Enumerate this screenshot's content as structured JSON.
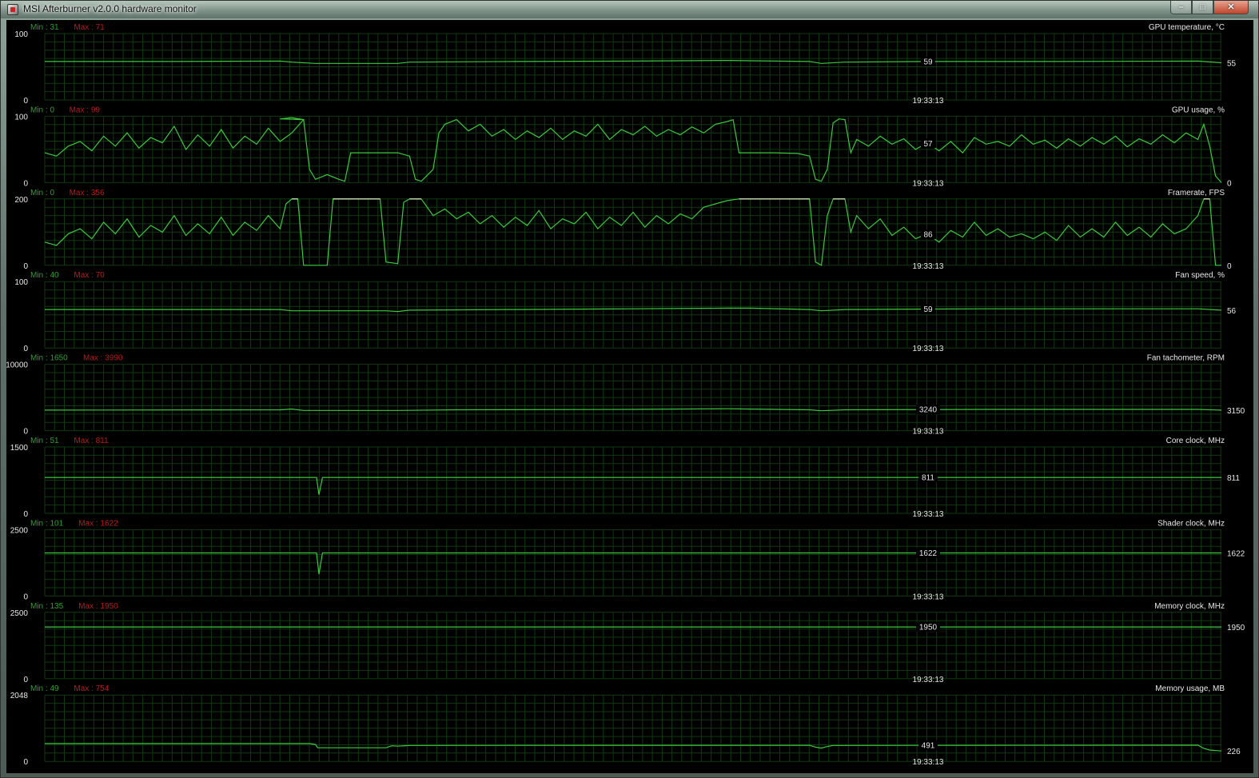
{
  "window": {
    "title": "MSI Afterburner v2.0.0 hardware monitor",
    "buttons": {
      "minimize_icon": "minimize-icon",
      "maximize_icon": "maximize-icon",
      "close_icon": "close-icon"
    }
  },
  "colors": {
    "line": "#3cc83c",
    "grid": "#0e3a0e",
    "min_text": "#2ea02e",
    "max_text": "#c01818",
    "text": "#e8e8e8",
    "saturated_line": "#f0f0d8"
  },
  "time_label": "19:33:13",
  "panels": [
    {
      "title": "GPU temperature, °C",
      "min_label": "Min : 31",
      "max_label": "Max : 71",
      "y_max": 100,
      "y_min": 0,
      "y_max_label": "100",
      "y_min_label": "0",
      "cursor_value": "59",
      "current_value": "55",
      "series": [
        [
          0,
          58
        ],
        [
          0.1,
          58
        ],
        [
          0.2,
          58.5
        ],
        [
          0.21,
          57
        ],
        [
          0.23,
          55
        ],
        [
          0.3,
          55
        ],
        [
          0.31,
          57
        ],
        [
          0.4,
          58
        ],
        [
          0.5,
          58.5
        ],
        [
          0.58,
          59.5
        ],
        [
          0.6,
          59
        ],
        [
          0.65,
          58
        ],
        [
          0.66,
          55
        ],
        [
          0.68,
          57
        ],
        [
          0.75,
          58
        ],
        [
          0.85,
          58
        ],
        [
          0.98,
          58.5
        ],
        [
          1,
          56
        ]
      ]
    },
    {
      "title": "GPU usage, %",
      "min_label": "Min : 0",
      "max_label": "Max : 99",
      "y_max": 100,
      "y_min": 0,
      "y_max_label": "100",
      "y_min_label": "0",
      "cursor_value": "57",
      "current_value": "0",
      "series": [
        [
          0,
          45
        ],
        [
          0.01,
          40
        ],
        [
          0.02,
          55
        ],
        [
          0.03,
          62
        ],
        [
          0.04,
          48
        ],
        [
          0.05,
          70
        ],
        [
          0.06,
          55
        ],
        [
          0.07,
          75
        ],
        [
          0.08,
          52
        ],
        [
          0.09,
          68
        ],
        [
          0.1,
          60
        ],
        [
          0.11,
          85
        ],
        [
          0.12,
          50
        ],
        [
          0.13,
          72
        ],
        [
          0.14,
          55
        ],
        [
          0.15,
          80
        ],
        [
          0.16,
          52
        ],
        [
          0.17,
          70
        ],
        [
          0.18,
          58
        ],
        [
          0.19,
          82
        ],
        [
          0.2,
          62
        ],
        [
          0.21,
          75
        ],
        [
          0.22,
          95
        ],
        [
          0.2,
          96
        ],
        [
          0.21,
          98
        ],
        [
          0.22,
          95
        ],
        [
          0.225,
          20
        ],
        [
          0.23,
          5
        ],
        [
          0.24,
          12
        ],
        [
          0.25,
          5
        ],
        [
          0.255,
          2
        ],
        [
          0.26,
          45
        ],
        [
          0.27,
          45
        ],
        [
          0.3,
          45
        ],
        [
          0.31,
          40
        ],
        [
          0.315,
          5
        ],
        [
          0.32,
          2
        ],
        [
          0.33,
          20
        ],
        [
          0.335,
          75
        ],
        [
          0.34,
          88
        ],
        [
          0.35,
          95
        ],
        [
          0.36,
          78
        ],
        [
          0.37,
          88
        ],
        [
          0.38,
          70
        ],
        [
          0.39,
          80
        ],
        [
          0.4,
          65
        ],
        [
          0.41,
          78
        ],
        [
          0.42,
          68
        ],
        [
          0.43,
          82
        ],
        [
          0.44,
          65
        ],
        [
          0.45,
          78
        ],
        [
          0.46,
          70
        ],
        [
          0.47,
          88
        ],
        [
          0.48,
          65
        ],
        [
          0.49,
          80
        ],
        [
          0.5,
          72
        ],
        [
          0.51,
          85
        ],
        [
          0.52,
          70
        ],
        [
          0.53,
          80
        ],
        [
          0.54,
          72
        ],
        [
          0.55,
          84
        ],
        [
          0.56,
          75
        ],
        [
          0.57,
          88
        ],
        [
          0.58,
          92
        ],
        [
          0.585,
          95
        ],
        [
          0.59,
          45
        ],
        [
          0.6,
          45
        ],
        [
          0.62,
          45
        ],
        [
          0.64,
          44
        ],
        [
          0.65,
          40
        ],
        [
          0.655,
          5
        ],
        [
          0.66,
          2
        ],
        [
          0.665,
          20
        ],
        [
          0.67,
          90
        ],
        [
          0.675,
          96
        ],
        [
          0.68,
          95
        ],
        [
          0.685,
          45
        ],
        [
          0.69,
          65
        ],
        [
          0.7,
          55
        ],
        [
          0.71,
          70
        ],
        [
          0.72,
          58
        ],
        [
          0.73,
          66
        ],
        [
          0.74,
          50
        ],
        [
          0.75,
          60
        ],
        [
          0.76,
          48
        ],
        [
          0.77,
          62
        ],
        [
          0.78,
          45
        ],
        [
          0.79,
          68
        ],
        [
          0.8,
          58
        ],
        [
          0.81,
          62
        ],
        [
          0.82,
          55
        ],
        [
          0.83,
          72
        ],
        [
          0.84,
          58
        ],
        [
          0.85,
          64
        ],
        [
          0.86,
          52
        ],
        [
          0.87,
          66
        ],
        [
          0.88,
          55
        ],
        [
          0.89,
          68
        ],
        [
          0.9,
          58
        ],
        [
          0.91,
          70
        ],
        [
          0.92,
          54
        ],
        [
          0.93,
          66
        ],
        [
          0.94,
          58
        ],
        [
          0.95,
          72
        ],
        [
          0.96,
          60
        ],
        [
          0.97,
          75
        ],
        [
          0.98,
          65
        ],
        [
          0.985,
          88
        ],
        [
          0.99,
          55
        ],
        [
          0.995,
          10
        ],
        [
          1,
          0
        ]
      ]
    },
    {
      "title": "Framerate, FPS",
      "min_label": "Min : 0",
      "max_label": "Max : 356",
      "y_max": 200,
      "y_min": 0,
      "y_max_label": "200",
      "y_min_label": "0",
      "cursor_value": "86",
      "current_value": "0",
      "series": [
        [
          0,
          70
        ],
        [
          0.01,
          60
        ],
        [
          0.02,
          95
        ],
        [
          0.03,
          110
        ],
        [
          0.04,
          80
        ],
        [
          0.05,
          130
        ],
        [
          0.06,
          95
        ],
        [
          0.07,
          140
        ],
        [
          0.08,
          85
        ],
        [
          0.09,
          120
        ],
        [
          0.1,
          100
        ],
        [
          0.11,
          150
        ],
        [
          0.12,
          90
        ],
        [
          0.13,
          125
        ],
        [
          0.14,
          95
        ],
        [
          0.15,
          145
        ],
        [
          0.16,
          90
        ],
        [
          0.17,
          130
        ],
        [
          0.18,
          105
        ],
        [
          0.19,
          150
        ],
        [
          0.2,
          110
        ],
        [
          0.205,
          185
        ],
        [
          0.21,
          200
        ],
        [
          0.215,
          200
        ],
        [
          0.22,
          0
        ],
        [
          0.23,
          0
        ],
        [
          0.24,
          0
        ],
        [
          0.245,
          200
        ],
        [
          0.28,
          200
        ],
        [
          0.285,
          200
        ],
        [
          0.29,
          10
        ],
        [
          0.3,
          5
        ],
        [
          0.305,
          190
        ],
        [
          0.31,
          200
        ],
        [
          0.32,
          200
        ],
        [
          0.33,
          150
        ],
        [
          0.34,
          170
        ],
        [
          0.35,
          140
        ],
        [
          0.36,
          160
        ],
        [
          0.37,
          125
        ],
        [
          0.38,
          150
        ],
        [
          0.39,
          115
        ],
        [
          0.4,
          145
        ],
        [
          0.41,
          120
        ],
        [
          0.42,
          165
        ],
        [
          0.43,
          110
        ],
        [
          0.44,
          140
        ],
        [
          0.45,
          125
        ],
        [
          0.46,
          160
        ],
        [
          0.47,
          110
        ],
        [
          0.48,
          145
        ],
        [
          0.49,
          120
        ],
        [
          0.5,
          160
        ],
        [
          0.51,
          115
        ],
        [
          0.52,
          150
        ],
        [
          0.53,
          125
        ],
        [
          0.54,
          155
        ],
        [
          0.55,
          140
        ],
        [
          0.56,
          175
        ],
        [
          0.57,
          185
        ],
        [
          0.58,
          195
        ],
        [
          0.59,
          200
        ],
        [
          0.6,
          200
        ],
        [
          0.64,
          200
        ],
        [
          0.65,
          200
        ],
        [
          0.655,
          10
        ],
        [
          0.66,
          0
        ],
        [
          0.665,
          150
        ],
        [
          0.67,
          200
        ],
        [
          0.675,
          200
        ],
        [
          0.68,
          200
        ],
        [
          0.685,
          100
        ],
        [
          0.69,
          150
        ],
        [
          0.7,
          110
        ],
        [
          0.71,
          140
        ],
        [
          0.72,
          90
        ],
        [
          0.73,
          115
        ],
        [
          0.74,
          80
        ],
        [
          0.75,
          95
        ],
        [
          0.76,
          70
        ],
        [
          0.77,
          105
        ],
        [
          0.78,
          85
        ],
        [
          0.79,
          130
        ],
        [
          0.8,
          90
        ],
        [
          0.81,
          110
        ],
        [
          0.82,
          85
        ],
        [
          0.83,
          95
        ],
        [
          0.84,
          80
        ],
        [
          0.85,
          100
        ],
        [
          0.86,
          75
        ],
        [
          0.87,
          120
        ],
        [
          0.88,
          85
        ],
        [
          0.89,
          110
        ],
        [
          0.9,
          85
        ],
        [
          0.91,
          130
        ],
        [
          0.92,
          90
        ],
        [
          0.93,
          115
        ],
        [
          0.94,
          85
        ],
        [
          0.95,
          125
        ],
        [
          0.96,
          95
        ],
        [
          0.97,
          110
        ],
        [
          0.98,
          150
        ],
        [
          0.985,
          200
        ],
        [
          0.99,
          200
        ],
        [
          0.995,
          0
        ],
        [
          1,
          0
        ]
      ]
    },
    {
      "title": "Fan speed, %",
      "min_label": "Min : 40",
      "max_label": "Max : 70",
      "y_max": 100,
      "y_min": 0,
      "y_max_label": "100",
      "y_min_label": "0",
      "cursor_value": "59",
      "current_value": "56",
      "series": [
        [
          0,
          58
        ],
        [
          0.1,
          58
        ],
        [
          0.2,
          58
        ],
        [
          0.21,
          56
        ],
        [
          0.23,
          56
        ],
        [
          0.29,
          56
        ],
        [
          0.3,
          55
        ],
        [
          0.31,
          57
        ],
        [
          0.4,
          58
        ],
        [
          0.5,
          59
        ],
        [
          0.58,
          60
        ],
        [
          0.6,
          60
        ],
        [
          0.65,
          58
        ],
        [
          0.66,
          56
        ],
        [
          0.68,
          58
        ],
        [
          0.8,
          59
        ],
        [
          0.9,
          59
        ],
        [
          0.98,
          59
        ],
        [
          1,
          57
        ]
      ]
    },
    {
      "title": "Fan tachometer, RPM",
      "min_label": "Min : 1650",
      "max_label": "Max : 3990",
      "y_max": 10000,
      "y_min": 0,
      "y_max_label": "10000",
      "y_min_label": "0",
      "cursor_value": "3240",
      "current_value": "3150",
      "series": [
        [
          0,
          3100
        ],
        [
          0.2,
          3150
        ],
        [
          0.21,
          3250
        ],
        [
          0.22,
          3050
        ],
        [
          0.3,
          3050
        ],
        [
          0.35,
          3150
        ],
        [
          0.5,
          3200
        ],
        [
          0.58,
          3300
        ],
        [
          0.6,
          3250
        ],
        [
          0.65,
          3150
        ],
        [
          0.66,
          3000
        ],
        [
          0.68,
          3150
        ],
        [
          0.8,
          3200
        ],
        [
          0.98,
          3200
        ],
        [
          1,
          3100
        ]
      ]
    },
    {
      "title": "Core clock, MHz",
      "min_label": "Min : 51",
      "max_label": "Max : 811",
      "y_max": 1500,
      "y_min": 0,
      "y_max_label": "1500",
      "y_min_label": "0",
      "cursor_value": "811",
      "current_value": "811",
      "series": [
        [
          0,
          811
        ],
        [
          0.231,
          811
        ],
        [
          0.233,
          420
        ],
        [
          0.236,
          811
        ],
        [
          1,
          811
        ]
      ]
    },
    {
      "title": "Shader clock, MHz",
      "min_label": "Min : 101",
      "max_label": "Max : 1622",
      "y_max": 2500,
      "y_min": 0,
      "y_max_label": "2500",
      "y_min_label": "0",
      "cursor_value": "1622",
      "current_value": "1622",
      "series": [
        [
          0,
          1622
        ],
        [
          0.231,
          1622
        ],
        [
          0.233,
          820
        ],
        [
          0.236,
          1622
        ],
        [
          1,
          1622
        ]
      ]
    },
    {
      "title": "Memory clock, MHz",
      "min_label": "Min : 135",
      "max_label": "Max : 1950",
      "y_max": 2500,
      "y_min": 0,
      "y_max_label": "2500",
      "y_min_label": "0",
      "cursor_value": "1950",
      "current_value": "1950",
      "series": [
        [
          0,
          1950
        ],
        [
          1,
          1950
        ]
      ]
    },
    {
      "title": "Memory usage, MB",
      "min_label": "Min : 49",
      "max_label": "Max : 754",
      "y_max": 2048,
      "y_min": 0,
      "y_max_label": "2048",
      "y_min_label": "0",
      "cursor_value": "491",
      "current_value": "226",
      "series": [
        [
          0,
          550
        ],
        [
          0.225,
          550
        ],
        [
          0.23,
          520
        ],
        [
          0.232,
          420
        ],
        [
          0.29,
          420
        ],
        [
          0.295,
          480
        ],
        [
          0.3,
          470
        ],
        [
          0.31,
          490
        ],
        [
          0.5,
          495
        ],
        [
          0.65,
          495
        ],
        [
          0.655,
          440
        ],
        [
          0.66,
          410
        ],
        [
          0.665,
          460
        ],
        [
          0.67,
          490
        ],
        [
          0.8,
          495
        ],
        [
          0.98,
          500
        ],
        [
          0.985,
          400
        ],
        [
          0.99,
          350
        ],
        [
          1,
          320
        ]
      ]
    }
  ]
}
